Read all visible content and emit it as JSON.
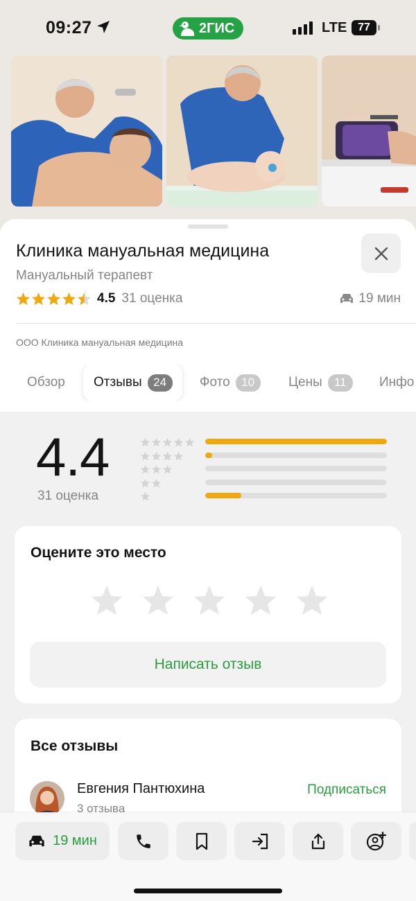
{
  "status_bar": {
    "time": "09:27",
    "brand": "2ГИС",
    "network": "LTE",
    "battery": "77"
  },
  "place": {
    "title": "Клиника мануальная медицина",
    "category": "Мануальный терапевт",
    "rating": "4.5",
    "rating_count": "31 оценка",
    "drive_time": "19 мин",
    "organization": "ООО Клиника мануальная медицина"
  },
  "tabs": [
    {
      "label": "Обзор",
      "badge": ""
    },
    {
      "label": "Отзывы",
      "badge": "24"
    },
    {
      "label": "Фото",
      "badge": "10"
    },
    {
      "label": "Цены",
      "badge": "11"
    },
    {
      "label": "Инфо",
      "badge": ""
    }
  ],
  "active_tab": "Отзывы",
  "summary": {
    "score": "4.4",
    "count_label": "31 оценка",
    "distribution": [
      {
        "stars": 5,
        "fraction": 1.0
      },
      {
        "stars": 4,
        "fraction": 0.04
      },
      {
        "stars": 3,
        "fraction": 0.0
      },
      {
        "stars": 2,
        "fraction": 0.0
      },
      {
        "stars": 1,
        "fraction": 0.2
      }
    ]
  },
  "rate_card": {
    "title": "Оцените это место",
    "button": "Написать отзыв"
  },
  "reviews_card": {
    "title": "Все отзывы",
    "reviewer_name": "Евгения Пантюхина",
    "reviewer_reviews": "3 отзыва",
    "subscribe": "Подписаться"
  },
  "bottom_bar": {
    "route_label": "19 мин",
    "icons": [
      "car-icon",
      "phone-icon",
      "bookmark-icon",
      "enter-icon",
      "share-icon",
      "add-person-icon"
    ]
  },
  "colors": {
    "brand_green": "#25a244",
    "action_green": "#2a9c3f",
    "star_gold": "#efa80f",
    "background": "#f1f1f1"
  }
}
